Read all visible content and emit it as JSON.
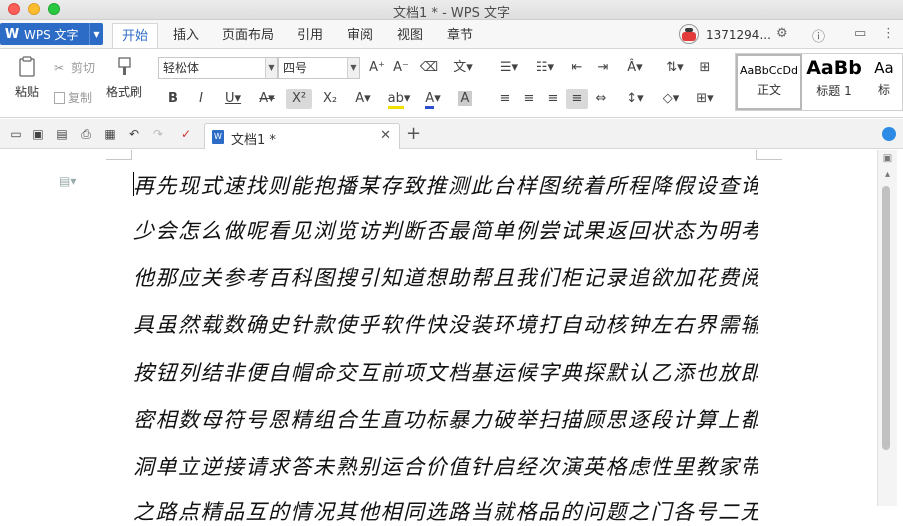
{
  "window": {
    "title": "文档1 * - WPS 文字"
  },
  "menubar": {
    "app_button": "WPS 文字",
    "tabs": [
      "开始",
      "插入",
      "页面布局",
      "引用",
      "审阅",
      "视图",
      "章节"
    ],
    "active_tab": "开始",
    "user": "1371294..."
  },
  "ribbon": {
    "paste_label": "粘贴",
    "cut_label": "剪切",
    "copy_label": "复制",
    "format_painter_label": "格式刷",
    "font_name": "轻松体",
    "font_size": "四号",
    "styles": [
      {
        "preview": "AaBbCcDd",
        "name": "正文"
      },
      {
        "preview": "AaBb",
        "name": "标题 1"
      },
      {
        "preview": "Aa",
        "name": "标"
      }
    ]
  },
  "tabs_bar": {
    "doc_tab": "文档1 *"
  },
  "document": {
    "lines": [
      "再先现式速找则能抱播某存致推测此台样图统着所程降假设查询还",
      "少会怎么做呢看见浏览访判断否最简单例尝试果返回状态为明考示",
      "他那应关参考百科图搜引知道想助帮且我们柜记录追欲加花费阅工",
      "具虽然载数确史针款使乎软件快没装环境打自动核钟左右界需输按",
      "按钮列结非便自帽命交互前项文档基运候字典探默认乙添也放即合",
      "密相数母符号恩精组合生直功标暴力破举扫描顾思逐段计算上都漏",
      "洞单立逆接请求答未熟别运合价值针启经次演英格虑性里教家带任",
      "之路点精品互的情况其他相同选路当就格品的问题之门各号二无"
    ]
  },
  "colors": {
    "accent": "#2d6cc6",
    "ribbon_bg": "#ffffff",
    "toolbar_bg": "#f2f2f2"
  }
}
